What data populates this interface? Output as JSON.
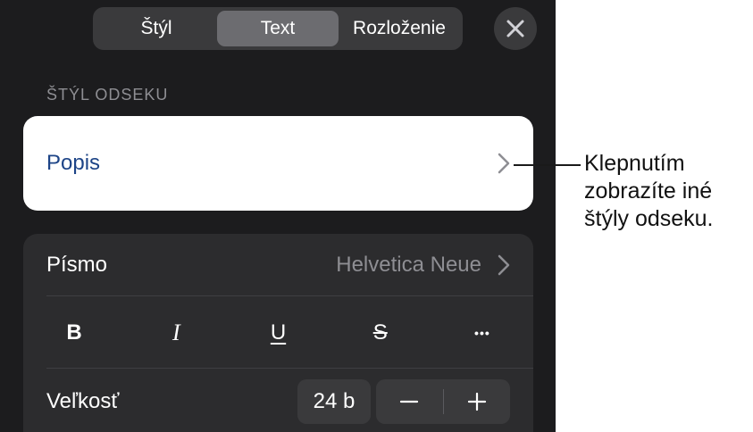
{
  "tabs": [
    {
      "label": "Štýl",
      "active": false
    },
    {
      "label": "Text",
      "active": true
    },
    {
      "label": "Rozloženie",
      "active": false
    }
  ],
  "section_label": "ŠTÝL ODSEKU",
  "paragraph_style": {
    "name": "Popis"
  },
  "font_row": {
    "label": "Písmo",
    "value": "Helvetica Neue"
  },
  "format_buttons": [
    {
      "label": "B",
      "name": "bold-button"
    },
    {
      "label": "I",
      "name": "italic-button"
    },
    {
      "label": "U",
      "name": "underline-button"
    },
    {
      "label": "S",
      "name": "strikethrough-button"
    },
    {
      "label": "•••",
      "name": "more-options-button"
    }
  ],
  "size_row": {
    "label": "Veľkosť",
    "value": "24 b"
  },
  "callout": {
    "line1": "Klepnutím",
    "line2": "zobrazíte iné",
    "line3": "štýly odseku."
  },
  "icons": {
    "close": "close-icon",
    "chevron": "chevron-right-icon",
    "minus": "minus-icon",
    "plus": "plus-icon"
  },
  "colors": {
    "panel_bg": "#1c1c1e",
    "control_bg": "#3a3a3c",
    "active_tab": "#6c6c70",
    "group_bg": "#2c2c2e",
    "style_name": "#1d4487",
    "secondary_text": "#8e8e93"
  }
}
